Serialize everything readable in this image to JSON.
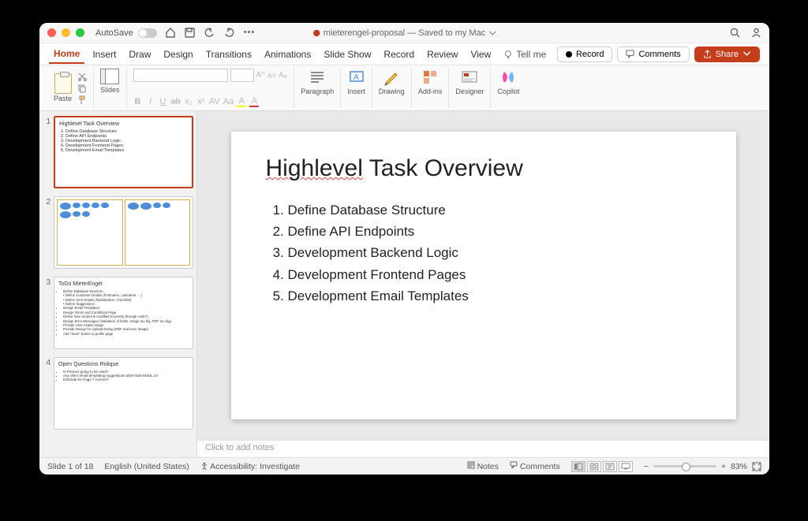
{
  "titlebar": {
    "autosave_label": "AutoSave",
    "doc_title": "mieterengel-proposal — Saved to my Mac"
  },
  "tabs": {
    "items": [
      "Home",
      "Insert",
      "Draw",
      "Design",
      "Transitions",
      "Animations",
      "Slide Show",
      "Record",
      "Review",
      "View"
    ],
    "tellme": "Tell me",
    "record": "Record",
    "comments": "Comments",
    "share": "Share"
  },
  "ribbon": {
    "paste": "Paste",
    "slides": "Slides",
    "paragraph": "Paragraph",
    "insert": "Insert",
    "drawing": "Drawing",
    "addins": "Add-ins",
    "designer": "Designer",
    "copilot": "Copilot"
  },
  "thumbs": {
    "s1": {
      "title": "Highlevel Task Overview",
      "items": [
        "Define Database Structure",
        "Define API Endpoints",
        "Development Backend Logic",
        "Development Frontend Pages",
        "Development Email Templates"
      ]
    },
    "s3": {
      "title": "ToDo MieterEngel",
      "items": [
        "Define Database Structure",
        "  • Define Customer Details (Firstname, Lastname, …)",
        "  • Define QA2 Details (Radiobutton, Checklist)",
        "  • Define Suggestions",
        "Design Email Templates",
        "Design Terms and Conditions Page",
        "Define how content is modified (currently through code?)",
        "Design Error Messages (Validation of fields, Image too big, PDF too big)",
        "Provide User Avatar Image",
        "Provide Design for Upload Dialog (PDF and User Image)",
        "Add \"Save\" button to profile page"
      ]
    },
    "s4": {
      "title": "Open Questions Rolique",
      "items": [
        "Is Flexbox going to be used?",
        "Any other email templating suggestions other than MJML.io?",
        "Estimate for Page 7 Correct?"
      ]
    }
  },
  "slide": {
    "title_u": "Highlevel",
    "title_rest": " Task Overview",
    "items": [
      "Define Database Structure",
      "Define API Endpoints",
      "Development Backend Logic",
      "Development Frontend Pages",
      "Development Email Templates"
    ]
  },
  "notes_placeholder": "Click to add notes",
  "status": {
    "slide": "Slide 1 of 18",
    "lang": "English (United States)",
    "access": "Accessibility: Investigate",
    "notes": "Notes",
    "comments": "Comments",
    "zoom": "83%"
  }
}
